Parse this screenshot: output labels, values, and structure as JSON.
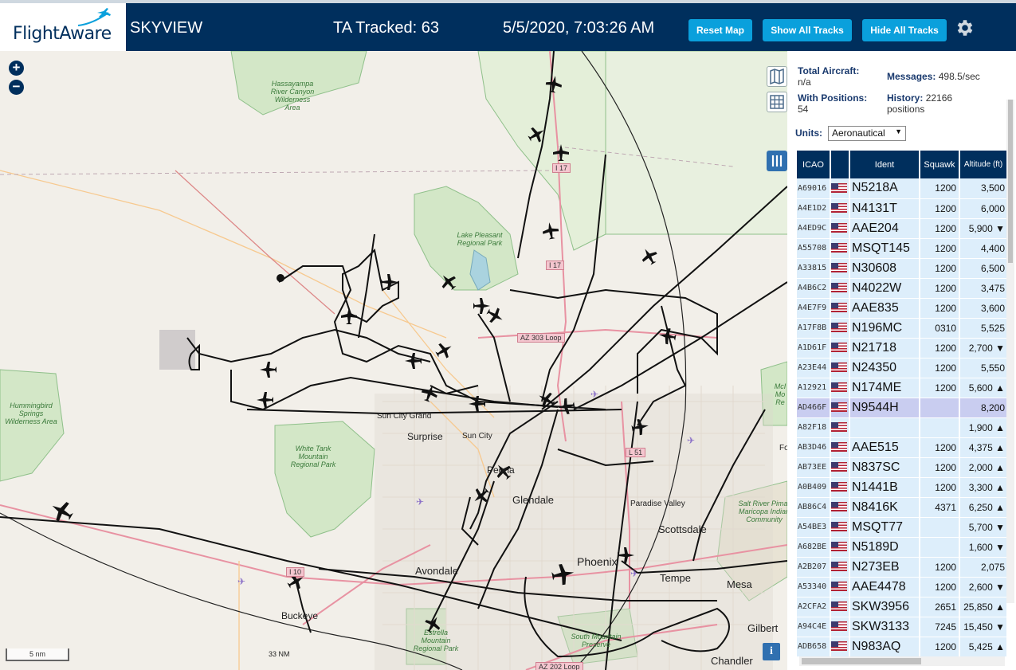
{
  "header": {
    "logo_text": "FlightAware",
    "app_title": "SKYVIEW",
    "tracked_label": "TA Tracked: 63",
    "datetime": "5/5/2020, 7:03:26 AM",
    "reset_label": "Reset Map",
    "show_label": "Show All Tracks",
    "hide_label": "Hide All Tracks"
  },
  "stats": {
    "total_label": "Total Aircraft:",
    "total_value": "n/a",
    "messages_label": "Messages:",
    "messages_value": "498.5/sec",
    "positions_label": "With Positions:",
    "positions_value": "54",
    "history_label": "History:",
    "history_value": "22166 positions"
  },
  "units": {
    "label": "Units:",
    "selected": "Aeronautical"
  },
  "table": {
    "headers": {
      "icao": "ICAO",
      "ident": "Ident",
      "squawk": "Squawk",
      "altitude": "Altitude (ft)"
    },
    "rows": [
      {
        "icao": "A69016",
        "ident": "N5218A",
        "squawk": "1200",
        "alt": "3,500"
      },
      {
        "icao": "A4E1D2",
        "ident": "N4131T",
        "squawk": "1200",
        "alt": "6,000"
      },
      {
        "icao": "A4ED9C",
        "ident": "AAE204",
        "squawk": "1200",
        "alt": "5,900 ▼"
      },
      {
        "icao": "A55708",
        "ident": "MSQT145",
        "squawk": "1200",
        "alt": "4,400"
      },
      {
        "icao": "A33815",
        "ident": "N30608",
        "squawk": "1200",
        "alt": "6,500"
      },
      {
        "icao": "A4B6C2",
        "ident": "N4022W",
        "squawk": "1200",
        "alt": "3,475"
      },
      {
        "icao": "A4E7F9",
        "ident": "AAE835",
        "squawk": "1200",
        "alt": "3,600"
      },
      {
        "icao": "A17F8B",
        "ident": "N196MC",
        "squawk": "0310",
        "alt": "5,525"
      },
      {
        "icao": "A1D61F",
        "ident": "N21718",
        "squawk": "1200",
        "alt": "2,700 ▼"
      },
      {
        "icao": "A23E44",
        "ident": "N24350",
        "squawk": "1200",
        "alt": "5,550"
      },
      {
        "icao": "A12921",
        "ident": "N174ME",
        "squawk": "1200",
        "alt": "5,600 ▲"
      },
      {
        "icao": "AD466F",
        "ident": "N9544H",
        "squawk": "",
        "alt": "8,200"
      },
      {
        "icao": "A82F18",
        "ident": "",
        "squawk": "",
        "alt": "1,900 ▲"
      },
      {
        "icao": "AB3D46",
        "ident": "AAE515",
        "squawk": "1200",
        "alt": "4,375 ▲"
      },
      {
        "icao": "AB73EE",
        "ident": "N837SC",
        "squawk": "1200",
        "alt": "2,000 ▲"
      },
      {
        "icao": "A0B409",
        "ident": "N1441B",
        "squawk": "1200",
        "alt": "3,300 ▲"
      },
      {
        "icao": "AB86C4",
        "ident": "N8416K",
        "squawk": "4371",
        "alt": "6,250 ▲"
      },
      {
        "icao": "A54BE3",
        "ident": "MSQT77",
        "squawk": "",
        "alt": "5,700 ▼"
      },
      {
        "icao": "A682BE",
        "ident": "N5189D",
        "squawk": "",
        "alt": "1,600 ▼"
      },
      {
        "icao": "A2B207",
        "ident": "N273EB",
        "squawk": "1200",
        "alt": "2,075"
      },
      {
        "icao": "A53340",
        "ident": "AAE4478",
        "squawk": "1200",
        "alt": "2,600 ▼"
      },
      {
        "icao": "A2CFA2",
        "ident": "SKW3956",
        "squawk": "2651",
        "alt": "25,850 ▲"
      },
      {
        "icao": "A94C4E",
        "ident": "SKW3133",
        "squawk": "7245",
        "alt": "15,450 ▼"
      },
      {
        "icao": "ADB658",
        "ident": "N983AQ",
        "squawk": "1200",
        "alt": "5,425 ▲"
      }
    ]
  },
  "map": {
    "scale": "5 nm",
    "range_ring": "33 NM",
    "places": [
      {
        "name": "Sun City Grand"
      },
      {
        "name": "Surprise"
      },
      {
        "name": "Sun City"
      },
      {
        "name": "Peoria"
      },
      {
        "name": "Glendale"
      },
      {
        "name": "Paradise Valley"
      },
      {
        "name": "Scottsdale"
      },
      {
        "name": "Avondale"
      },
      {
        "name": "Phoenix"
      },
      {
        "name": "Tempe"
      },
      {
        "name": "Mesa"
      },
      {
        "name": "Buckeye"
      },
      {
        "name": "Gilbert"
      },
      {
        "name": "Chandler"
      },
      {
        "name": "Fo"
      }
    ],
    "parks": [
      "Hassayampa River Canyon Wilderness Area",
      "Lake Pleasant Regional Park",
      "Hummingbird Springs Wilderness Area",
      "White Tank Mountain Regional Park",
      "Salt River Pima-Maricopa Indian Community",
      "South Mountain Preserve",
      "Estrella Mountain Regional Park",
      "McI Mo Re"
    ],
    "highways": [
      "I 17",
      "I 17",
      "AZ 303 Loop",
      "I 10",
      "L 51",
      "AZ 202 Loop"
    ]
  },
  "colors": {
    "header_bg": "#002f5d",
    "button_bg": "#0aa0dc",
    "row_bg": "#ddeefb",
    "row_selected": "#c9cdf0"
  }
}
